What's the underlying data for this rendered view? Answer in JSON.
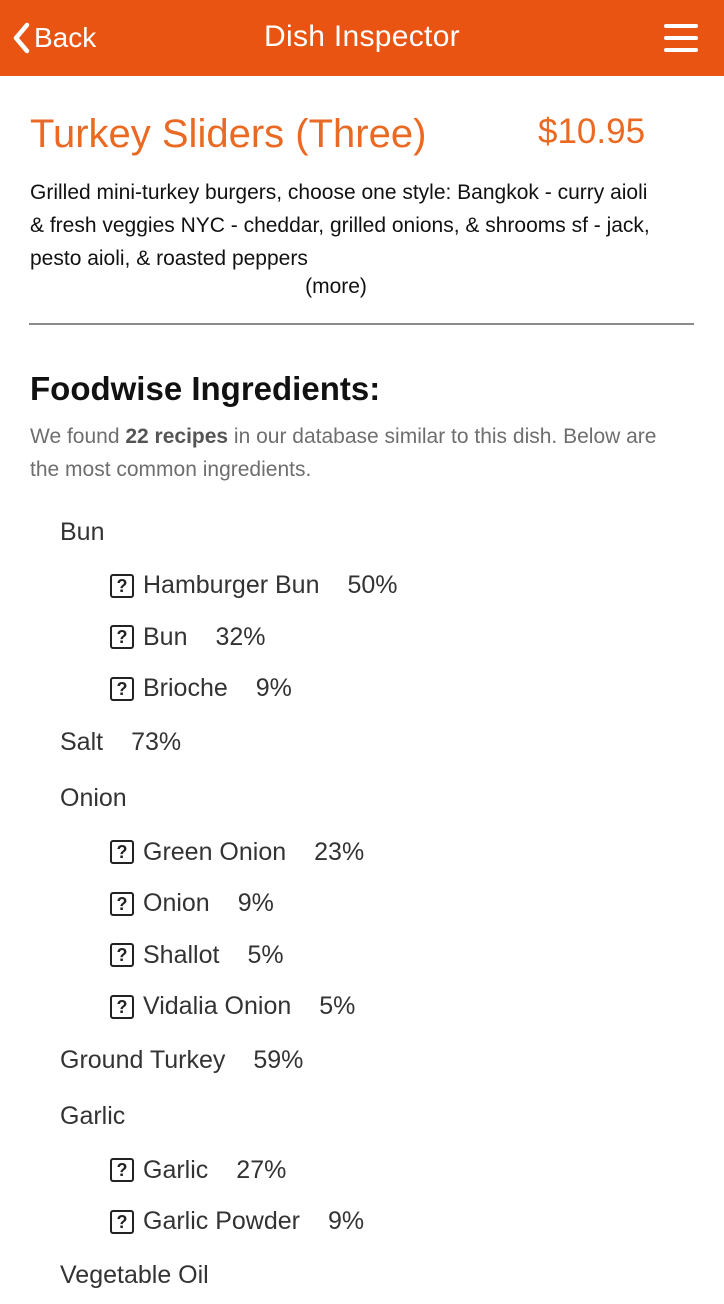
{
  "colors": {
    "accent": "#e95413",
    "title": "#ea6a23"
  },
  "navbar": {
    "back_label": "Back",
    "title": "Dish Inspector",
    "back_icon": "chevron-left-icon",
    "menu_icon": "hamburger-menu-icon"
  },
  "dish": {
    "name": "Turkey Sliders (Three)",
    "price": "$10.95",
    "description": "Grilled mini-turkey burgers, choose one style: Bangkok - curry aioli & fresh veggies NYC - cheddar, grilled onions, & shrooms sf - jack, pesto aioli, & roasted peppers",
    "more_label": "(more)"
  },
  "ingredients_section": {
    "heading": "Foodwise Ingredients:",
    "intro_prefix": "We found ",
    "recipe_count": "22 recipes",
    "intro_suffix": " in our database similar to this dish. Below are the most common ingredients.",
    "help_icon": "question-box-icon",
    "groups": [
      {
        "name": "Bun",
        "pct": "",
        "items": [
          {
            "name": "Hamburger Bun",
            "pct": "50%"
          },
          {
            "name": "Bun",
            "pct": "32%"
          },
          {
            "name": "Brioche",
            "pct": "9%"
          }
        ]
      },
      {
        "name": "Salt",
        "pct": "73%",
        "items": []
      },
      {
        "name": "Onion",
        "pct": "",
        "items": [
          {
            "name": "Green Onion",
            "pct": "23%"
          },
          {
            "name": "Onion",
            "pct": "9%"
          },
          {
            "name": "Shallot",
            "pct": "5%"
          },
          {
            "name": "Vidalia Onion",
            "pct": "5%"
          }
        ]
      },
      {
        "name": "Ground Turkey",
        "pct": "59%",
        "items": []
      },
      {
        "name": "Garlic",
        "pct": "",
        "items": [
          {
            "name": "Garlic",
            "pct": "27%"
          },
          {
            "name": "Garlic Powder",
            "pct": "9%"
          }
        ]
      },
      {
        "name": "Vegetable Oil",
        "pct": "",
        "items": []
      }
    ]
  }
}
